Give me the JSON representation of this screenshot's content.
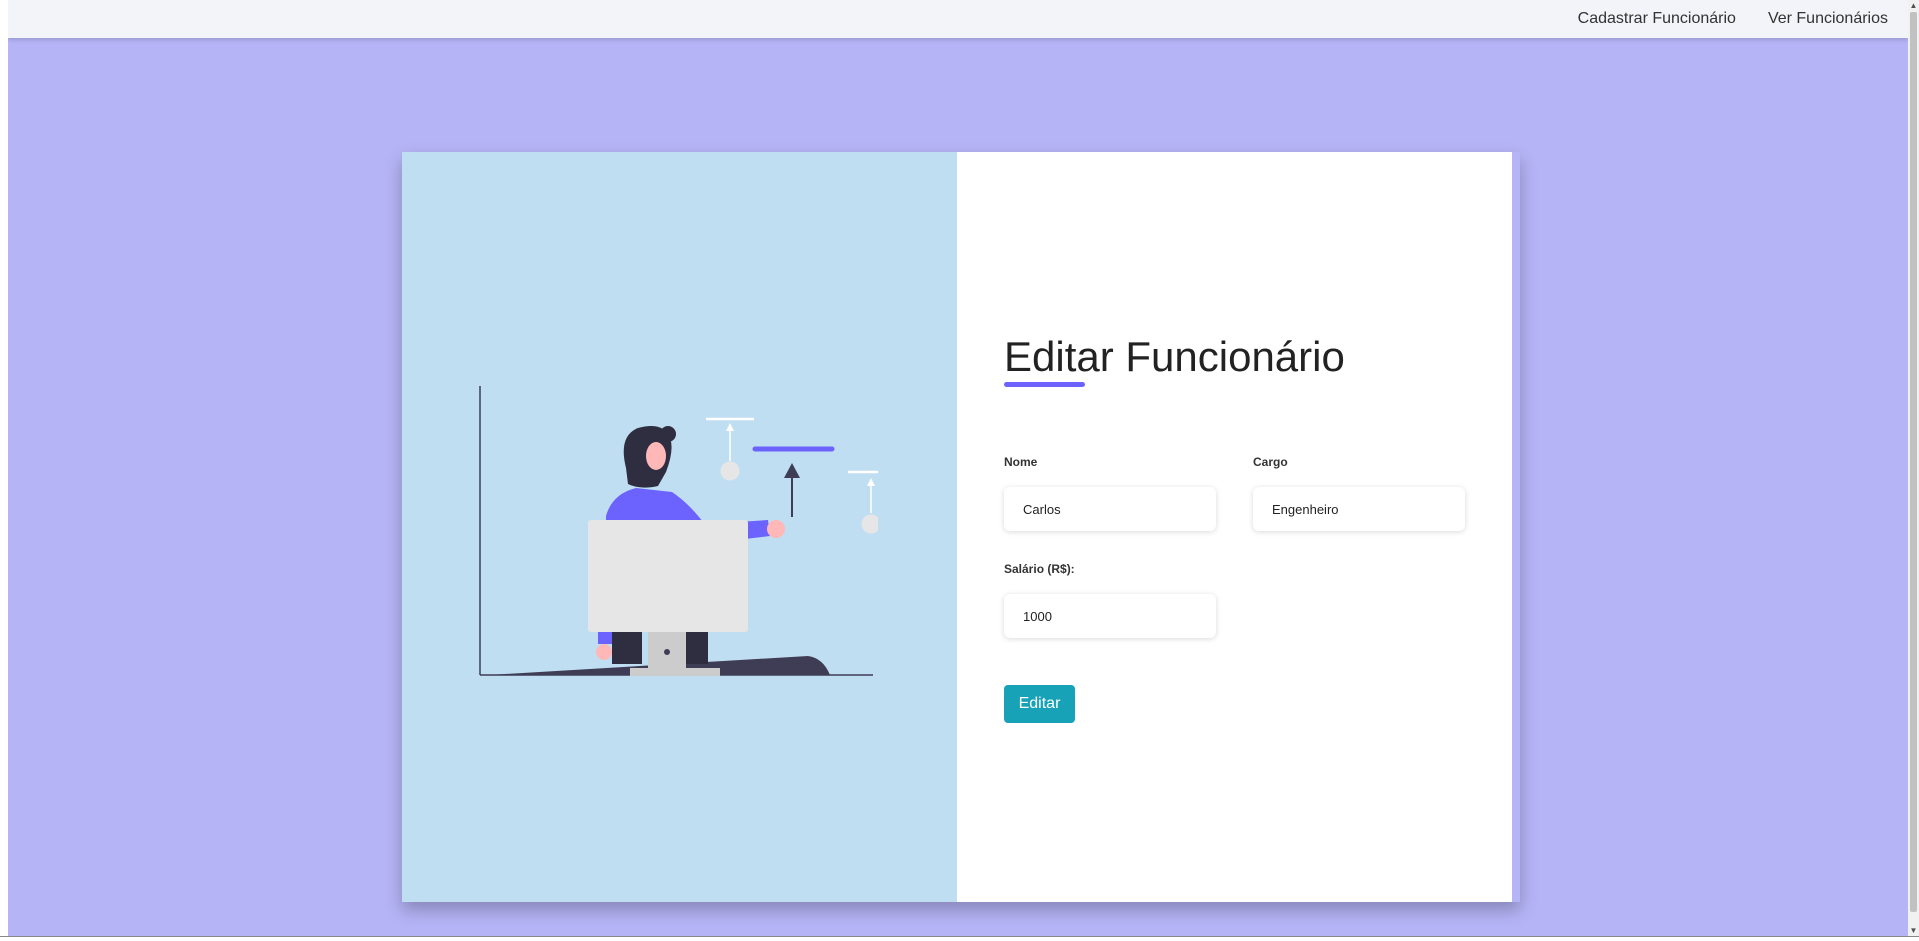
{
  "nav": {
    "links": [
      {
        "label": "Cadastrar Funcionário"
      },
      {
        "label": "Ver Funcionários"
      }
    ]
  },
  "form": {
    "title": "Editar Funcionário",
    "fields": {
      "nome": {
        "label": "Nome",
        "value": "Carlos"
      },
      "cargo": {
        "label": "Cargo",
        "value": "Engenheiro"
      },
      "salario": {
        "label": "Salário (R$):",
        "value": "1000"
      }
    },
    "submit_label": "Editar"
  },
  "illustration": {
    "icon": "person-at-monitor-with-chart-illustration"
  },
  "scrollbar": {
    "up_icon": "▲",
    "down_icon": "▼"
  },
  "colors": {
    "page_background": "#b5b4f6",
    "navbar_background": "#f3f3fa",
    "illustration_panel": "#c0def2",
    "accent": "#6c63ff",
    "submit_button": "#17a2b8"
  }
}
